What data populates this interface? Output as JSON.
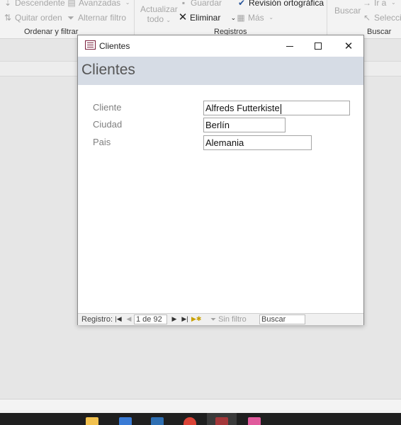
{
  "ribbon": {
    "sort_filter": {
      "descending": "Descendente",
      "advanced": "Avanzadas",
      "clear_sort": "Quitar orden",
      "toggle_filter": "Alternar filtro",
      "group_label": "Ordenar y filtrar"
    },
    "records": {
      "refresh_line1": "Actualizar",
      "refresh_line2": "todo",
      "save": "Guardar",
      "spelling": "Revisión ortográfica",
      "delete": "Eliminar",
      "more": "Más",
      "group_label": "Registros"
    },
    "find": {
      "find": "Buscar",
      "goto": "Ir a",
      "select": "Selecció",
      "group_label": "Buscar"
    }
  },
  "window": {
    "title": "Clientes",
    "form_title": "Clientes",
    "fields": [
      {
        "label": "Cliente",
        "value": "Alfreds Futterkiste"
      },
      {
        "label": "Ciudad",
        "value": "Berlín"
      },
      {
        "label": "Pais",
        "value": "Alemania"
      }
    ]
  },
  "record_nav": {
    "label": "Registro:",
    "current": "1 de 92",
    "filter_status": "Sin filtro",
    "search_placeholder": "Buscar"
  },
  "icons": [
    "sort-descending-icon",
    "advanced-filter-icon",
    "clear-sort-icon",
    "funnel-icon",
    "refresh-icon",
    "save-icon",
    "checkmark-icon",
    "delete-x-icon",
    "more-table-icon",
    "find-icon",
    "goto-arrow-icon",
    "select-cursor-icon",
    "form-icon",
    "minimize-icon",
    "maximize-icon",
    "close-icon"
  ],
  "colors": {
    "header_band": "#d6dce5",
    "access_red": "#a4373a",
    "spelling_check": "#2b579a"
  }
}
